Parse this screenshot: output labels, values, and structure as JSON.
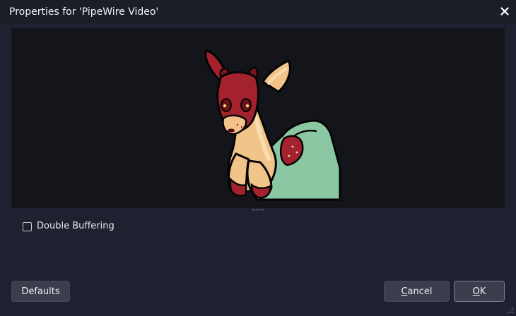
{
  "window": {
    "title": "Properties for 'PipeWire Video'",
    "close_icon": "close-icon"
  },
  "preview": {
    "description_icon": "deer-image"
  },
  "options": {
    "double_buffering": {
      "label": "Double Buffering",
      "checked": false
    }
  },
  "buttons": {
    "defaults": "Defaults",
    "cancel_mnemonic": "C",
    "cancel_rest": "ancel",
    "ok_mnemonic": "O",
    "ok_rest": "K"
  },
  "colors": {
    "background": "#1f2130",
    "preview_bg": "#13151b",
    "button": "#3a3e4d",
    "text": "#eeeff3"
  }
}
